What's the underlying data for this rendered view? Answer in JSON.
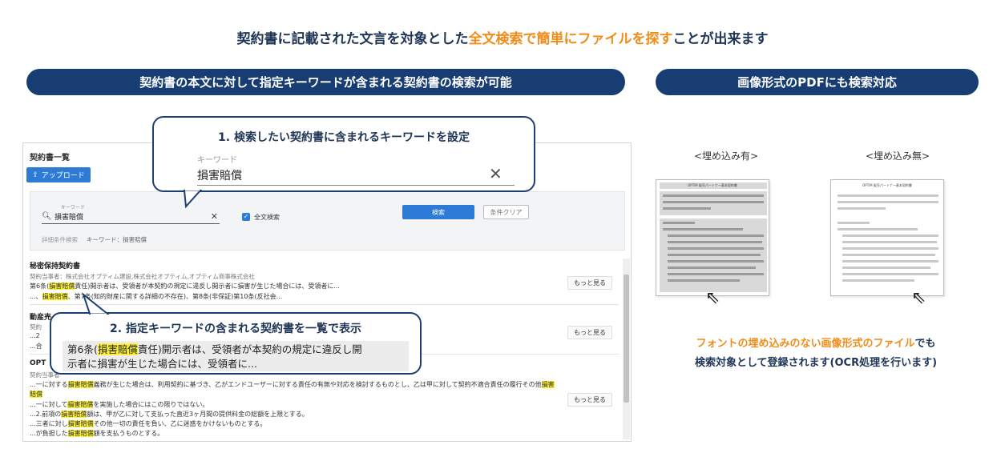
{
  "headline": {
    "pre": "契約書に記載された文言を対象とした",
    "highlight": "全文検索で簡単にファイルを探す",
    "post": "ことが出来ます"
  },
  "pills": {
    "left": "契約書の本文に対して指定キーワードが含まれる契約書の検索が可能",
    "right": "画像形式のPDFにも検索対応"
  },
  "app": {
    "title": "契約書一覧",
    "upload_label": "アップロード",
    "keyword_label": "キーワード",
    "keyword_value": "損害賠償",
    "fulltext_label": "全文検索",
    "search_label": "検索",
    "clear_label": "条件クリア",
    "detail_label": "詳細条件検索",
    "detail_value": "キーワード：損害賠償",
    "more_label": "もっと見る",
    "results": [
      {
        "title": "秘密保持契約書",
        "parties": "契約当事者：株式会社オプティム建設,株式会社オプティム,オプティム商事株式会社",
        "l1_pre": "第6条(",
        "l1_mark": "損害賠償",
        "l1_post": "責任)開示者は、受領者が本契約の規定に違反し開示者に損害が生じた場合には、受領者に...",
        "l2_pre": "...、",
        "l2_mark": "損害賠償",
        "l2_post": "、第7条(知的財産に関する詳細の不存在)、第8条(非保証)第10条(反社会..."
      },
      {
        "title": "動産売",
        "parties": "契約",
        "l1": "...2",
        "l2": "...合"
      },
      {
        "title": "OPT",
        "parties": "契約当事者",
        "lines": [
          {
            "pre": "...一に対する",
            "mark": "損害賠償",
            "post": "義務が生じた場合は、利用契約に基づき、乙がエンドユーザーに対する責任の有無や対応を検討するものとし、乙は甲に対して契約不適合責任の履行その他",
            "mark2": "損害"
          },
          {
            "pre": "",
            "mark": "賠償",
            "post": ""
          },
          {
            "pre": "...一に対して",
            "mark": "損害賠償",
            "post": "を実施した場合にはこの限りではない。"
          },
          {
            "pre": "...2.前項の",
            "mark": "損害賠償",
            "post": "額は、甲が乙に対して支払った直近3ヶ月間の提供料金の総額を上限とする。"
          },
          {
            "pre": "...三者に対し",
            "mark": "損害賠償",
            "post": "その他一切の責任を負い、乙に迷惑をかけないものとする。"
          },
          {
            "pre": "...が負担した",
            "mark": "損害賠償",
            "post": "額を支払うものとする。"
          }
        ]
      }
    ]
  },
  "callout1": {
    "title": "1. 検索したい契約書に含まれるキーワードを設定",
    "label": "キーワード",
    "value": "損害賠償"
  },
  "callout2": {
    "title": "2. 指定キーワードの含まれる契約書を一覧で表示",
    "s1_pre": "第6条(",
    "s1_mark": "損害賠償",
    "s1_post": "責任)開示者は、受領者が本契約の規定に違反し開",
    "s2": "示者に損害が生じた場合には、受領者に..."
  },
  "right": {
    "embedded_label": "<埋め込み有>",
    "not_embedded_label": "<埋め込み無>",
    "doc_title": "OPTiM 販売パートナー基本契約書",
    "text_hl": "フォントの埋め込みのない画像形式のファイル",
    "text_post": "でも",
    "text_line2": "検索対象として登録されます(OCR処理を行います)"
  },
  "colors": {
    "accent": "#f08c1a",
    "navy": "#183d73",
    "primary": "#2e7bd6",
    "highlight": "#fdf13a"
  }
}
